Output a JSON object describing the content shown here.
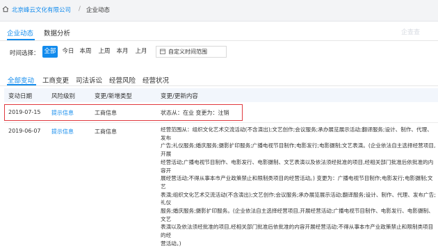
{
  "breadcrumb": {
    "company": "北京峰云文化有限公司",
    "separator": "/",
    "current": "企业动态"
  },
  "top_tabs": [
    {
      "label": "企业动态",
      "active": true
    },
    {
      "label": "数据分析",
      "active": false
    }
  ],
  "brand_watermark": "企查查",
  "time_filter": {
    "label": "时间选择：",
    "options": [
      "全部",
      "今日",
      "本周",
      "上周",
      "本月",
      "上月"
    ],
    "selected": "全部",
    "custom_label": "自定义时间范围"
  },
  "sub_tabs": [
    {
      "label": "全部变动",
      "active": true
    },
    {
      "label": "工商变更",
      "active": false
    },
    {
      "label": "司法诉讼",
      "active": false
    },
    {
      "label": "经营风险",
      "active": false
    },
    {
      "label": "经营状况",
      "active": false
    }
  ],
  "table": {
    "headers": [
      "变动日期",
      "风险级别",
      "变更/新增类型",
      "变更/更新内容"
    ],
    "rows": [
      {
        "date": "2019-07-15",
        "risk": "提示信息",
        "type": "工商信息",
        "content": "状态从：在业 变更为：注销",
        "highlighted": true
      },
      {
        "date": "2019-06-07",
        "risk": "提示信息",
        "type": "工商信息",
        "content_lines": [
          "经营范围从：组织文化艺术交流活动(不含演出);文艺创作;会议服务;承办展览展示活动;翻译服务;设计、制作、代理、发布",
          "广告;礼仪服务;婚庆服务;摄影扩印服务;广播电视节目制作;电影发行;电影摄制;文艺表演。(企业依法自主选择经营项目,开展",
          "经营活动;广播电视节目制作、电影发行、电影摄制、文艺表演以及依法须经批准的项目,经相关部门批准后依批准的内容开",
          "展经营活动;不得从事本市产业政策禁止和限制类项目的经营活动。) 变更为：广播电视节目制作;电影发行;电影摄制;文艺",
          "表演;组织文化艺术交流活动(不含演出);文艺创作;会议服务;承办展览展示活动;翻译服务;设计、制作、代理、发布广告;礼仪",
          "服务;婚庆服务;摄影扩印服务。(企业依法自主选择经营项目,开展经营活动;广播电视节目制作、电影发行、电影摄制、文艺",
          "表演以及依法须经批准的项目,经相关部门批准后依批准的内容开展经营活动;不得从事本市产业政策禁止和限制类项目的经",
          "营活动。)"
        ],
        "highlighted": false
      }
    ]
  },
  "colors": {
    "accent": "#128bed",
    "highlight_border": "#e0383e",
    "header_bg": "#f2f6fc",
    "topbar_bg": "#f3f4f6"
  }
}
